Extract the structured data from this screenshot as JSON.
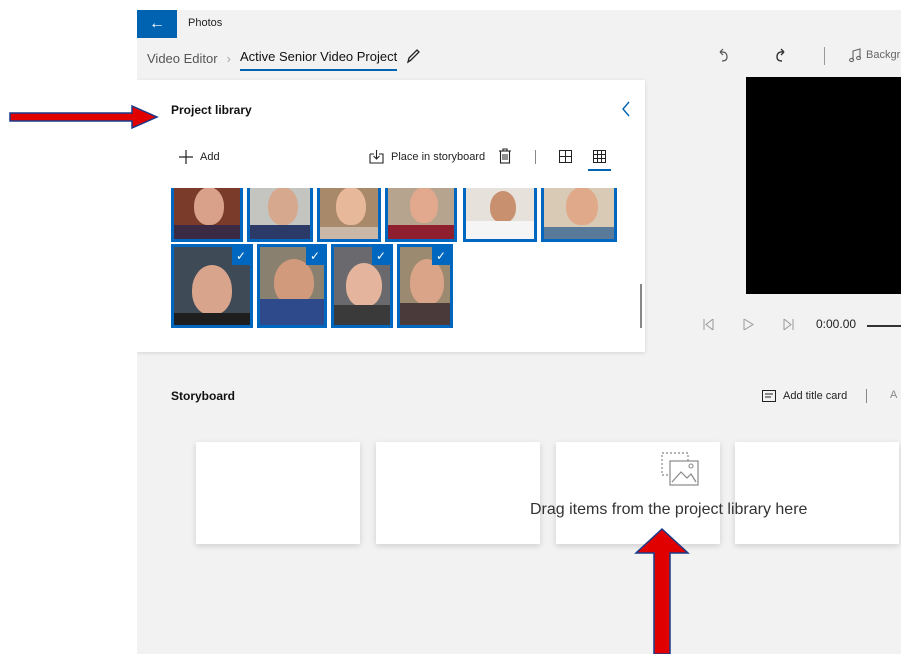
{
  "app": {
    "title": "Photos",
    "back_icon": "arrow-left-icon",
    "accent": "#0063b1"
  },
  "breadcrumb": {
    "root": "Video Editor",
    "current": "Active Senior Video Project"
  },
  "toolbar": {
    "background_music_label": "Backgr"
  },
  "library": {
    "title": "Project library",
    "add_label": "Add",
    "place_label": "Place in storyboard",
    "photos": [
      {
        "selected": true
      },
      {
        "selected": true
      },
      {
        "selected": true
      },
      {
        "selected": true
      },
      {
        "selected": true
      },
      {
        "selected": true
      },
      {
        "selected": true
      },
      {
        "selected": true
      },
      {
        "selected": true
      },
      {
        "selected": true
      }
    ]
  },
  "player": {
    "time": "0:00.00"
  },
  "storyboard": {
    "title": "Storyboard",
    "add_title_card_label": "Add title card",
    "more_label": "A",
    "drop_hint": "Drag items from the project library here"
  },
  "annotations": {
    "arrow_color": "#e00000",
    "arrow_outline": "#1a3a8a"
  }
}
